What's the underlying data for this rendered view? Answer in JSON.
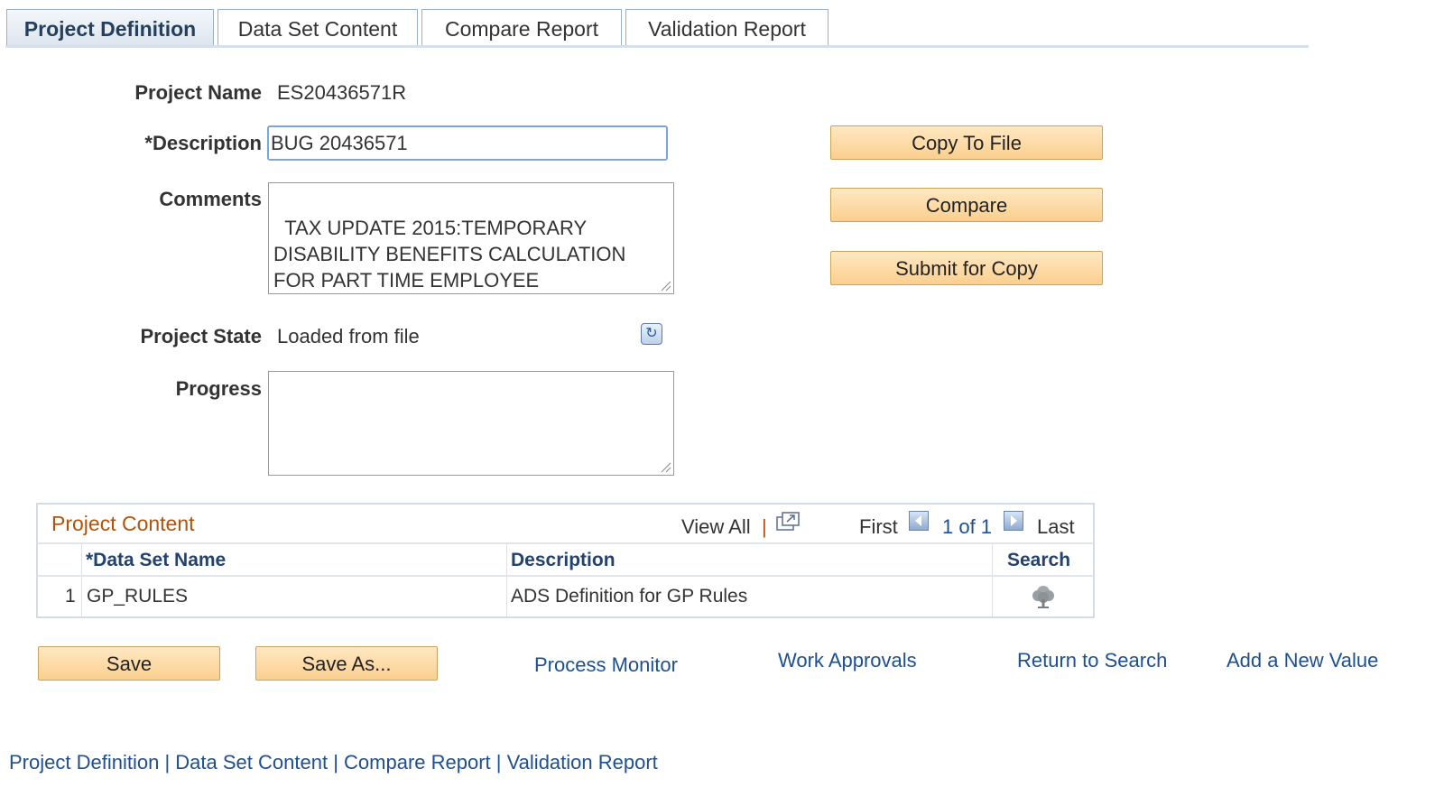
{
  "tabs": [
    {
      "label": "Project Definition",
      "active": true
    },
    {
      "label": "Data Set Content",
      "active": false
    },
    {
      "label": "Compare Report",
      "active": false
    },
    {
      "label": "Validation Report",
      "active": false
    }
  ],
  "form": {
    "project_name_label": "Project Name",
    "project_name_value": "ES20436571R",
    "description_label": "*Description",
    "description_value": "BUG 20436571",
    "comments_label": "Comments",
    "comments_value": "TAX UPDATE 2015:TEMPORARY\nDISABILITY BENEFITS CALCULATION\nFOR PART TIME EMPLOYEE",
    "project_state_label": "Project State",
    "project_state_value": "Loaded from file",
    "progress_label": "Progress",
    "progress_value": ""
  },
  "actions": {
    "copy_to_file": "Copy To File",
    "compare": "Compare",
    "submit_for_copy": "Submit for Copy"
  },
  "grid": {
    "title": "Project Content",
    "view_all": "View All",
    "separator": "|",
    "first": "First",
    "pager": "1 of 1",
    "last": "Last",
    "columns": [
      "*Data Set Name",
      "Description",
      "Search"
    ],
    "rows": [
      {
        "num": "1",
        "data_set_name": "GP_RULES",
        "description": "ADS Definition for GP Rules"
      }
    ]
  },
  "footer": {
    "save": "Save",
    "save_as": "Save As...",
    "process_monitor": "Process Monitor",
    "work_approvals": "Work Approvals",
    "return_to_search": "Return to Search",
    "add_new_value": "Add a New Value"
  },
  "bottom_links": {
    "project_definition": "Project Definition",
    "data_set_content": "Data Set Content",
    "compare_report": "Compare Report",
    "validation_report": "Validation Report",
    "separator": "|"
  },
  "colors": {
    "button_fill": "#fbcf8e",
    "link": "#1d4f91",
    "grid_title": "#b45309",
    "tab_active_text": "#24405f"
  },
  "icons": {
    "refresh": "refresh-icon",
    "view_all": "new-window-icon",
    "search": "tree-search-icon",
    "previous": "left-arrow-icon",
    "next": "right-arrow-icon"
  }
}
